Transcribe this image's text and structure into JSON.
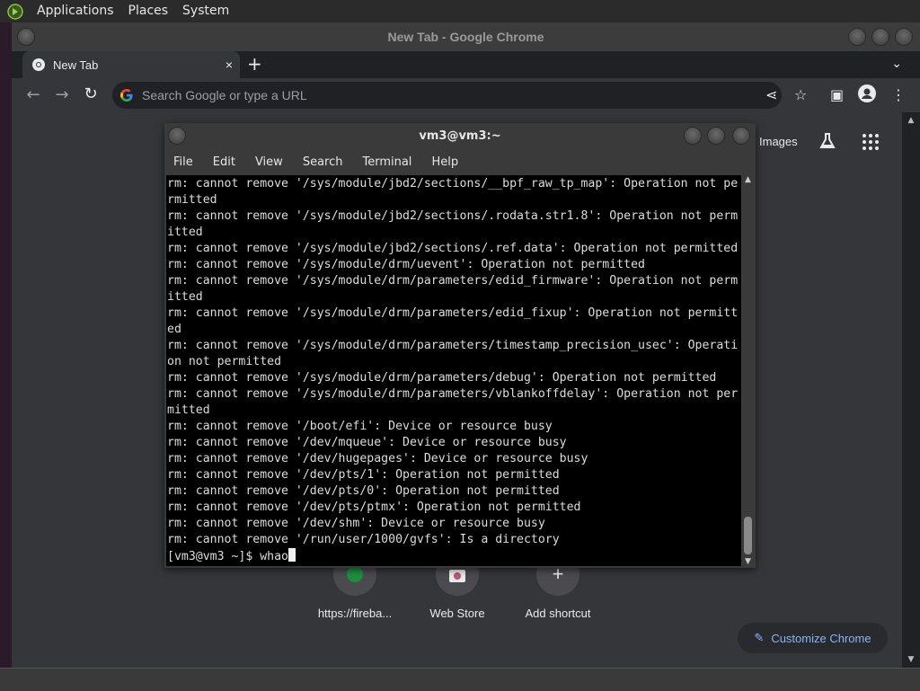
{
  "panel": {
    "menus": [
      "Applications",
      "Places",
      "System"
    ]
  },
  "chrome": {
    "window_title": "New Tab - Google Chrome",
    "tab_title": "New Tab",
    "tab_close": "×",
    "new_tab": "+",
    "tab_search": "⌄",
    "omnibox_placeholder": "Search Google or type a URL",
    "images_link": "Images",
    "shortcuts": [
      {
        "label": "https://fireba...",
        "icon": "firebase-icon"
      },
      {
        "label": "Web Store",
        "icon": "chrome-webstore-icon"
      },
      {
        "label": "Add shortcut",
        "icon": "plus-icon"
      }
    ],
    "customize_label": "Customize Chrome"
  },
  "terminal": {
    "title": "vm3@vm3:~",
    "menus": [
      "File",
      "Edit",
      "View",
      "Search",
      "Terminal",
      "Help"
    ],
    "lines": [
      "rm: cannot remove '/sys/module/jbd2/sections/__bpf_raw_tp_map': Operation not pe",
      "rmitted",
      "rm: cannot remove '/sys/module/jbd2/sections/.rodata.str1.8': Operation not perm",
      "itted",
      "rm: cannot remove '/sys/module/jbd2/sections/.ref.data': Operation not permitted",
      "rm: cannot remove '/sys/module/drm/uevent': Operation not permitted",
      "rm: cannot remove '/sys/module/drm/parameters/edid_firmware': Operation not perm",
      "itted",
      "rm: cannot remove '/sys/module/drm/parameters/edid_fixup': Operation not permitt",
      "ed",
      "rm: cannot remove '/sys/module/drm/parameters/timestamp_precision_usec': Operati",
      "on not permitted",
      "rm: cannot remove '/sys/module/drm/parameters/debug': Operation not permitted",
      "rm: cannot remove '/sys/module/drm/parameters/vblankoffdelay': Operation not per",
      "mitted",
      "rm: cannot remove '/boot/efi': Device or resource busy",
      "rm: cannot remove '/dev/mqueue': Device or resource busy",
      "rm: cannot remove '/dev/hugepages': Device or resource busy",
      "rm: cannot remove '/dev/pts/1': Operation not permitted",
      "rm: cannot remove '/dev/pts/0': Operation not permitted",
      "rm: cannot remove '/dev/pts/ptmx': Operation not permitted",
      "rm: cannot remove '/dev/shm': Device or resource busy",
      "rm: cannot remove '/run/user/1000/gvfs': Is a directory"
    ],
    "prompt": "[vm3@vm3 ~]$ ",
    "input": "whao"
  }
}
